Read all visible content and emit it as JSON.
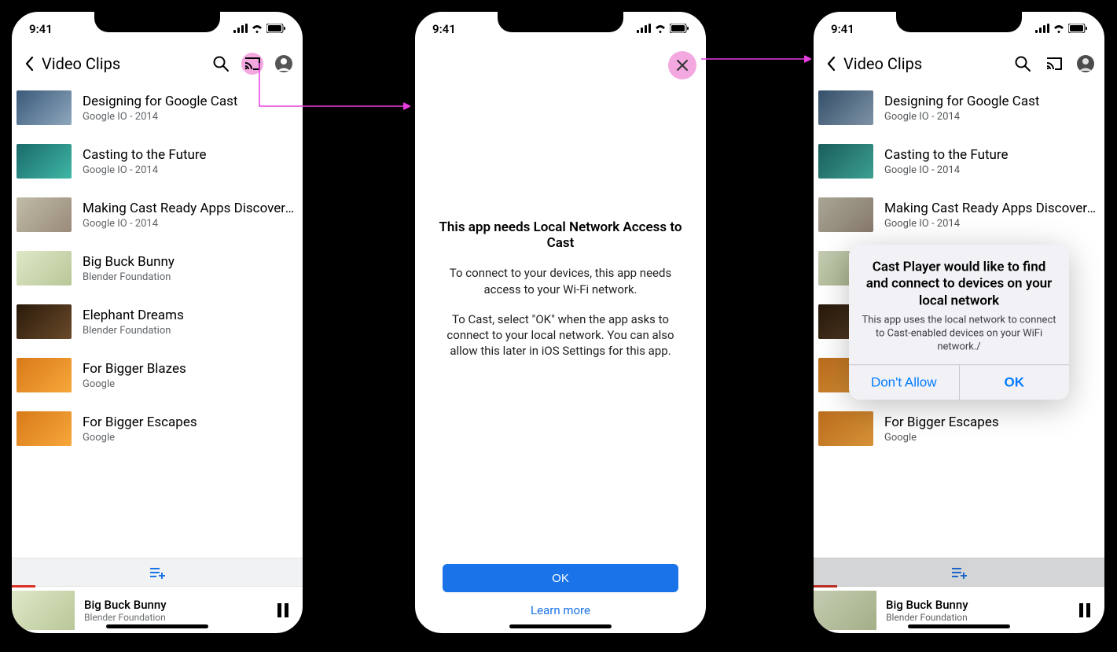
{
  "status": {
    "time": "9:41"
  },
  "nav": {
    "title": "Video Clips"
  },
  "videos": [
    {
      "title": "Designing for Google Cast",
      "sub": "Google IO - 2014"
    },
    {
      "title": "Casting to the Future",
      "sub": "Google IO - 2014"
    },
    {
      "title": "Making Cast Ready Apps Discoverable",
      "sub": "Google IO - 2014"
    },
    {
      "title": "Big Buck Bunny",
      "sub": "Blender Foundation"
    },
    {
      "title": "Elephant Dreams",
      "sub": "Blender Foundation"
    },
    {
      "title": "For Bigger Blazes",
      "sub": "Google"
    },
    {
      "title": "For Bigger Escapes",
      "sub": "Google"
    }
  ],
  "mini": {
    "title": "Big Buck Bunny",
    "sub": "Blender Foundation"
  },
  "perm": {
    "title": "This app needs Local Network Access to Cast",
    "p1": "To connect to your devices, this app needs access to your Wi-Fi network.",
    "p2": "To Cast, select \"OK\" when the app asks to connect to your local network. You can also allow this later in iOS Settings for this app.",
    "ok": "OK",
    "learn": "Learn more"
  },
  "alert": {
    "title": "Cast Player would like to find and connect to devices on your local network",
    "msg": "This app uses the local network to connect to Cast-enabled devices on your WiFi network./",
    "deny": "Don't Allow",
    "ok": "OK"
  }
}
